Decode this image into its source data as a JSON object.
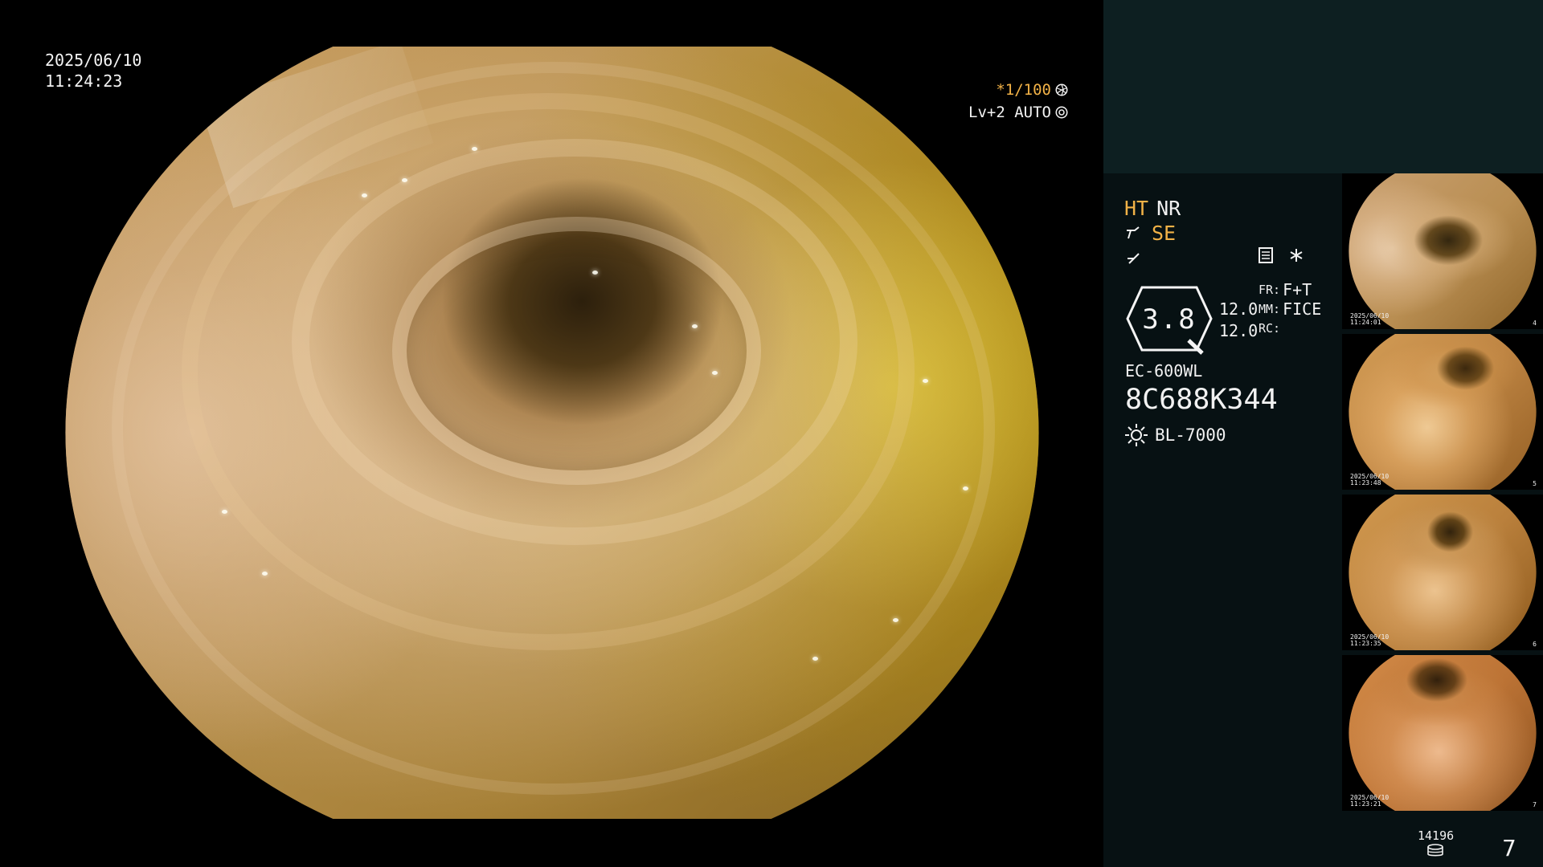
{
  "overlay": {
    "date": "2025/06/10",
    "time": "11:24:23"
  },
  "camera": {
    "shutter": "*1/100",
    "level": "Lv+2 AUTO"
  },
  "panel": {
    "mode_primary": "HT",
    "mode_secondary": "NR",
    "mode_tertiary": "SE",
    "zoom": "3.8",
    "metric_upper": "12.0",
    "metric_lower": "12.0",
    "fr_label": "FR:",
    "fr_value": "F+T",
    "mm_label": "MM:",
    "mm_value": "FICE",
    "rc_label": "RC:",
    "device_model": "EC-600WL",
    "device_serial": "8C688K344",
    "light_source": "BL-7000"
  },
  "footer": {
    "storage_number": "14196",
    "page_count": "7"
  },
  "thumbnails": [
    {
      "date": "2025/06/10",
      "time": "11:24:01",
      "index": "4"
    },
    {
      "date": "2025/06/10",
      "time": "11:23:48",
      "index": "5"
    },
    {
      "date": "2025/06/10",
      "time": "11:23:35",
      "index": "6"
    },
    {
      "date": "2025/06/10",
      "time": "11:23:21",
      "index": "7"
    }
  ],
  "icons": {
    "shutter": "aperture-icon",
    "auto": "auto-iris-icon",
    "nr_tool": "forceps-icon",
    "se_tool": "slash-icon",
    "settings": "menu-icon",
    "asterisk": "asterisk-icon",
    "light": "sun-icon",
    "storage": "drive-icon"
  },
  "colors": {
    "accent": "#f2b247",
    "panel_dark": "#071113",
    "panel_top": "#0d1f21"
  }
}
